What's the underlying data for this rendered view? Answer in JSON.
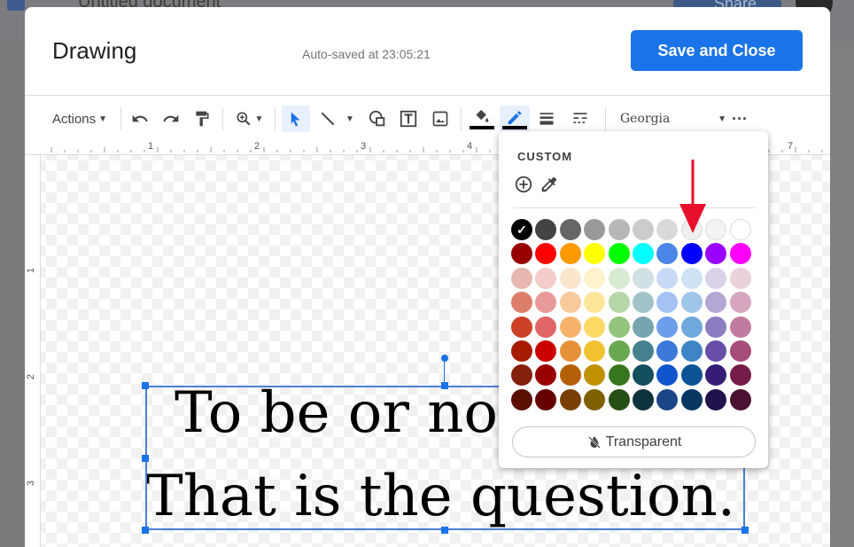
{
  "background": {
    "doc_title": "Untitled document",
    "share_label": "Share"
  },
  "dialog": {
    "title": "Drawing",
    "autosave": "Auto-saved at 23:05:21",
    "save_close_label": "Save and Close"
  },
  "toolbar": {
    "actions_label": "Actions",
    "font_name": "Georgia",
    "fill_underline_color": "#000000",
    "border_underline_color": "#000000"
  },
  "ruler": {
    "h_labels": [
      "1",
      "2",
      "3",
      "4",
      "7"
    ],
    "v_labels": [
      "1",
      "2",
      "3"
    ]
  },
  "text": {
    "line1": "To be or no",
    "line2": "That is the question."
  },
  "palette": {
    "custom_label": "CUSTOM",
    "transparent_label": "Transparent",
    "selected_color": "#000000",
    "rows": [
      [
        "#000000",
        "#434343",
        "#666666",
        "#999999",
        "#b7b7b7",
        "#cccccc",
        "#d9d9d9",
        "#efefef",
        "#f3f3f3",
        "#ffffff"
      ],
      [
        "#980000",
        "#ff0000",
        "#ff9900",
        "#ffff00",
        "#00ff00",
        "#00ffff",
        "#4a86e8",
        "#0000ff",
        "#9900ff",
        "#ff00ff"
      ],
      [
        "#e6b8af",
        "#f4cccc",
        "#fce5cd",
        "#fff2cc",
        "#d9ead3",
        "#d0e0e3",
        "#c9daf8",
        "#cfe2f3",
        "#d9d2e9",
        "#ead1dc"
      ],
      [
        "#dd7e6b",
        "#ea9999",
        "#f9cb9c",
        "#ffe599",
        "#b6d7a8",
        "#a2c4c9",
        "#a4c2f4",
        "#9fc5e8",
        "#b4a7d6",
        "#d5a6bd"
      ],
      [
        "#cc4125",
        "#e06666",
        "#f6b26b",
        "#ffd966",
        "#93c47d",
        "#76a5af",
        "#6d9eeb",
        "#6fa8dc",
        "#8e7cc3",
        "#c27ba0"
      ],
      [
        "#a61c00",
        "#cc0000",
        "#e69138",
        "#f1c232",
        "#6aa84f",
        "#45818e",
        "#3c78d8",
        "#3d85c6",
        "#674ea7",
        "#a64d79"
      ],
      [
        "#85200c",
        "#990000",
        "#b45f06",
        "#bf9000",
        "#38761d",
        "#134f5c",
        "#1155cc",
        "#0b5394",
        "#351c75",
        "#741b47"
      ],
      [
        "#5b0f00",
        "#660000",
        "#783f04",
        "#7f6000",
        "#274e13",
        "#0c343d",
        "#1c4587",
        "#073763",
        "#20124d",
        "#4c1130"
      ]
    ]
  },
  "annotation": {
    "arrow_color": "#e8102c"
  }
}
